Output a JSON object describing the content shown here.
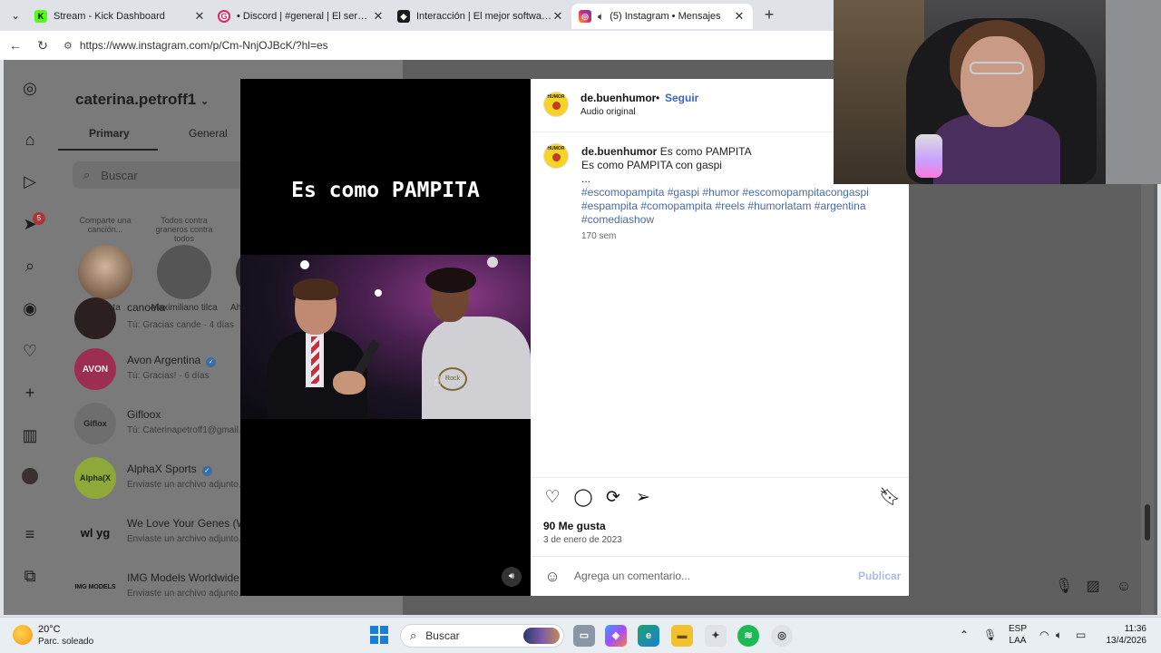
{
  "browser": {
    "tabs": [
      {
        "title": "Stream - Kick Dashboard",
        "favicon_color": "#53fc18",
        "favicon_glyph": "K"
      },
      {
        "title": "• Discord | #general | El servidor d",
        "favicon_color": "#e0245e",
        "favicon_glyph": "G"
      },
      {
        "title": "Interacción | El mejor software par",
        "favicon_color": "#1b1b1b",
        "favicon_glyph": "◆"
      },
      {
        "title": "(5) Instagram • Mensajes",
        "favicon_color": "#d62976",
        "favicon_glyph": "◎"
      }
    ],
    "url": "https://www.instagram.com/p/Cm-NnjOJBcK/?hl=es"
  },
  "instagram": {
    "notification_count": "5",
    "username": "caterina.petroff1",
    "tabs": [
      "Primary",
      "General"
    ],
    "search_placeholder": "Buscar",
    "stories": [
      {
        "bubble": "Comparte una canción...",
        "name": "Tu nota"
      },
      {
        "bubble": "Todos contra graneros contra todos",
        "name": "Maximiliano tilca"
      },
      {
        "bubble": "",
        "name": "Ahr"
      }
    ],
    "conversations": [
      {
        "name": "canoela",
        "preview": "Tú: Gracias cande · 4 días",
        "avatar_text": ""
      },
      {
        "name": "Avon Argentina",
        "preview": "Tú: Gracias! · 6 días",
        "avatar_text": "AVON",
        "verified": true
      },
      {
        "name": "Gifloox",
        "preview": "Tú: Caterinapetroff1@gmail.",
        "avatar_text": "Giflox"
      },
      {
        "name": "AlphaX Sports",
        "preview": "Enviaste un archivo adjunto.",
        "avatar_text": "Alpha(X",
        "verified": true
      },
      {
        "name": "We Love Your Genes (WL",
        "preview": "Enviaste un archivo adjunto.",
        "avatar_text": "wl yg"
      },
      {
        "name": "IMG Models Worldwide",
        "preview": "Enviaste un archivo adjunto. · 4 días",
        "avatar_text": "IMG MODELS"
      }
    ]
  },
  "post": {
    "video_caption": "Es como PAMPITA",
    "video_logo_text": "Rock",
    "author": "de.buenhumor",
    "avatar_text": "HUMOR",
    "follow_label": "Seguir",
    "audio": "Audio original",
    "caption_title": "Es como PAMPITA",
    "caption_line2": "Es como PAMPITA con gaspi",
    "caption_more": "...",
    "hashtags": "#escomopampita #gaspi #humor #escomopampitacongaspi #espampita #comopampita #reels #humorlatam #argentina #comediashow",
    "caption_time": "170 sem",
    "likes": "90 Me gusta",
    "date": "3 de enero de 2023",
    "comment_placeholder": "Agrega un comentario...",
    "publish_label": "Publicar"
  },
  "taskbar": {
    "temperature": "20°C",
    "weather": "Parc. soleado",
    "search_placeholder": "Buscar",
    "lang_line1": "ESP",
    "lang_line2": "LAA",
    "time": "11:36",
    "date": "13/4/2026"
  },
  "colors": {
    "accent": "#3d66b8",
    "hashtag": "#4a6aa8",
    "publish_disabled": "#a9bde8"
  }
}
